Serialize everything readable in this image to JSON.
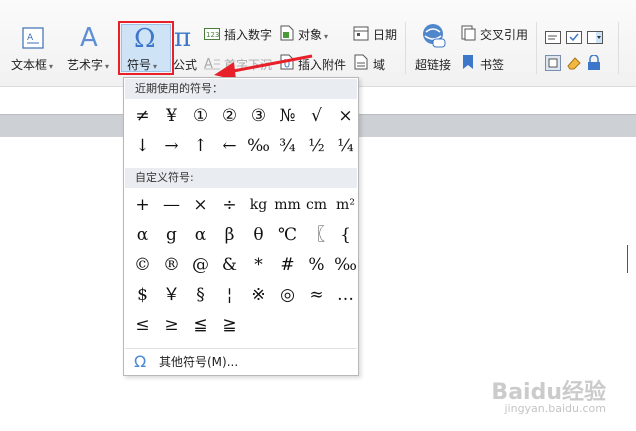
{
  "ribbon": {
    "textbox_label": "文本框",
    "wordart_label": "艺术字",
    "symbol_label": "符号",
    "formula_label": "公式",
    "insert_number_label": "插入数字",
    "dropcap_label": "首字下沉",
    "object_label": "对象",
    "attachment_label": "插入附件",
    "date_label": "日期",
    "field_label": "域",
    "hyperlink_label": "超链接",
    "crossref_label": "交叉引用",
    "bookmark_label": "书签"
  },
  "dropdown": {
    "recent_header": "近期使用的符号：",
    "recent_symbols": [
      "≠",
      "¥",
      "①",
      "②",
      "③",
      "№",
      "√",
      "×",
      "↓",
      "→",
      "↑",
      "←",
      "‰",
      "¾",
      "½",
      "¼"
    ],
    "custom_header": "自定义符号:",
    "custom_symbols": [
      "+",
      "—",
      "×",
      "÷",
      "kg",
      "mm",
      "cm",
      "m²",
      "α",
      "g",
      "α",
      "β",
      "θ",
      "℃",
      "〖",
      "{",
      "©",
      "®",
      "@",
      "&",
      "*",
      "#",
      "%",
      "‰",
      "$",
      "￥",
      "§",
      "¦",
      "※",
      "◎",
      "≈",
      "…",
      "≤",
      "≥",
      "≦",
      "≧"
    ],
    "more_label": "其他符号(M)..."
  },
  "watermark": {
    "brand": "Baidu经验",
    "url": "jingyan.baidu.com"
  },
  "colors": {
    "highlight": "#e8202a",
    "arrow": "#e8202a",
    "accent": "#4a8ad6"
  }
}
